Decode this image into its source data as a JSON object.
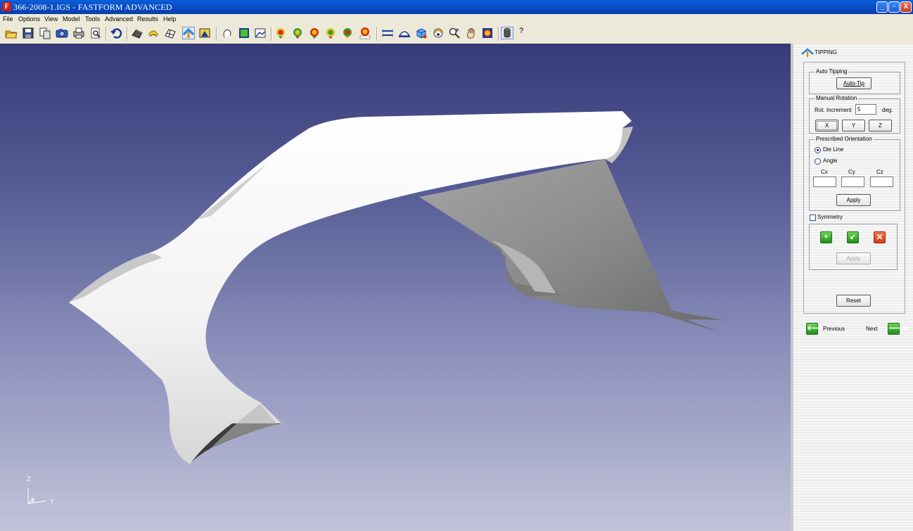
{
  "window": {
    "title": "366-2008-1.IGS - FASTFORM ADVANCED",
    "app_icon": "F",
    "minimize": "_",
    "maximize": "▫",
    "close": "X"
  },
  "menu": [
    "File",
    "Options",
    "View",
    "Model",
    "Tools",
    "Advanced",
    "Results",
    "Help"
  ],
  "toolbar": {
    "icons": [
      "open-folder-icon",
      "save-icon",
      "copy-icon",
      "camera-icon",
      "print-icon",
      "print-preview-icon",
      "undo-icon",
      "model-icon",
      "surface-icon",
      "mesh-icon",
      "tipping-icon",
      "blank-icon",
      "rotate-icon",
      "edge-icon",
      "trim-icon",
      "result-icon-1",
      "result-icon-2",
      "result-icon-3",
      "result-icon-4",
      "result-icon-5",
      "result-more-icon",
      "measure-icon",
      "section-icon",
      "cube-view-icon",
      "orbit-icon",
      "zoom-icon",
      "pan-icon",
      "fit-icon",
      "cylinder-icon",
      "help-icon"
    ],
    "help_glyph": "?"
  },
  "viewport": {
    "axis": {
      "z": "Z",
      "x": "X",
      "y": "Y"
    }
  },
  "panel": {
    "title": "TIPPING",
    "auto_tipping": {
      "label": "Auto Tipping",
      "button": "Auto-Tip"
    },
    "manual_rotation": {
      "label": "Manual Rotation",
      "increment_label": "Rot. Increment",
      "increment_value": "5",
      "unit": "deg.",
      "x": "X",
      "y": "Y",
      "z": "Z"
    },
    "prescribed": {
      "label": "Prescribed Orientation",
      "die_line": "Die Line",
      "angle": "Angle",
      "cx": "Cx",
      "cy": "Cy",
      "cz": "Cz",
      "cx_value": "",
      "cy_value": "",
      "cz_value": "",
      "apply": "Apply",
      "selected": "Die Line"
    },
    "symmetry": {
      "label": "Symmetry",
      "checked": false,
      "apply": "Apply",
      "add_glyph": "+",
      "pick_glyph": "↙",
      "delete_glyph": "✕"
    },
    "reset": "Reset",
    "nav": {
      "previous": "Previous",
      "next": "Next",
      "prev_glyph": "🡐",
      "next_glyph": "🡒"
    }
  },
  "colors": {
    "viewport_top": "#373a78",
    "viewport_bottom": "#c2c3d9",
    "accent_green": "#1f8f1f",
    "delete_red": "#d63a12"
  }
}
